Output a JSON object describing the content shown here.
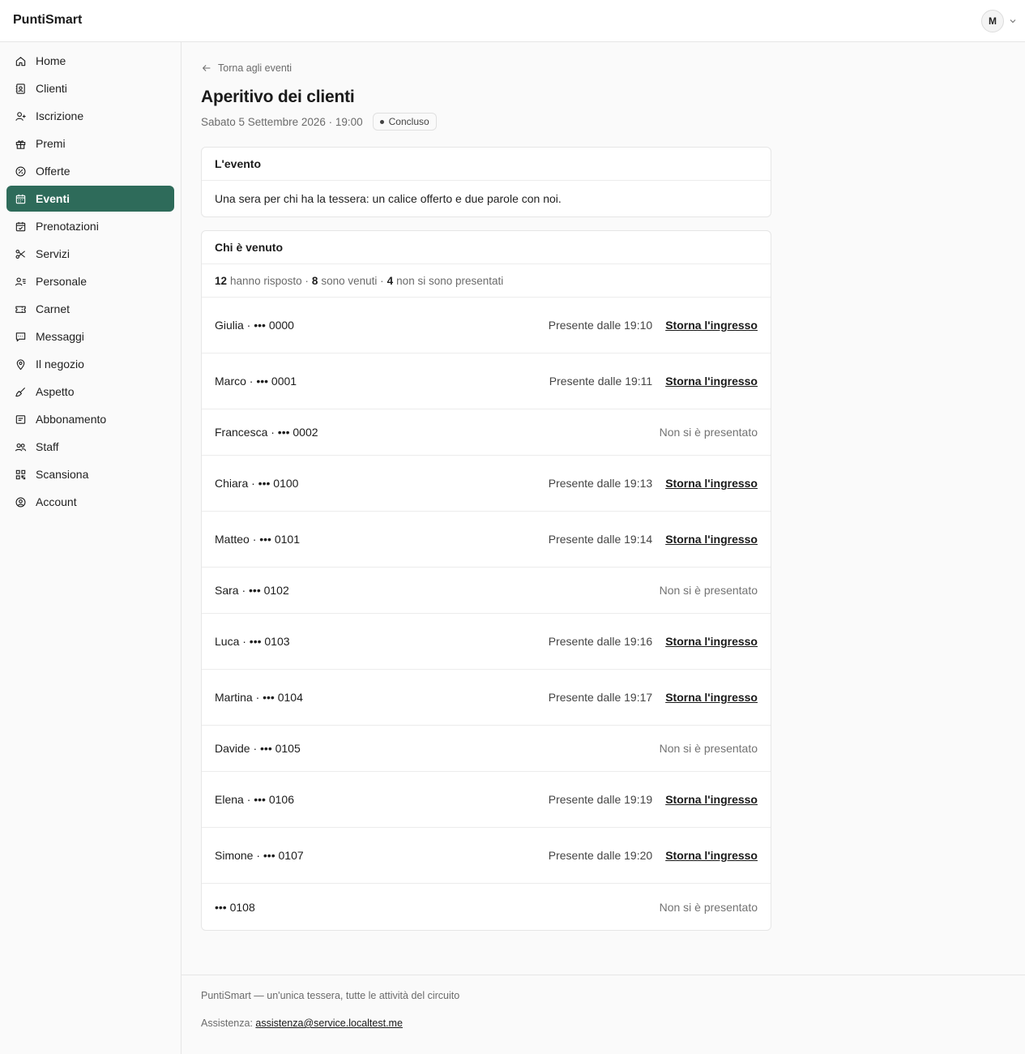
{
  "app": {
    "brand": "PuntiSmart",
    "avatar_initial": "M"
  },
  "sidebar": {
    "items": [
      {
        "label": "Home",
        "icon": "home-icon"
      },
      {
        "label": "Clienti",
        "icon": "contacts-icon"
      },
      {
        "label": "Iscrizione",
        "icon": "user-plus-icon"
      },
      {
        "label": "Premi",
        "icon": "gift-icon"
      },
      {
        "label": "Offerte",
        "icon": "percent-badge-icon"
      },
      {
        "label": "Eventi",
        "icon": "calendar-icon",
        "active": true
      },
      {
        "label": "Prenotazioni",
        "icon": "calendar-check-icon"
      },
      {
        "label": "Servizi",
        "icon": "scissors-icon"
      },
      {
        "label": "Personale",
        "icon": "user-list-icon"
      },
      {
        "label": "Carnet",
        "icon": "ticket-icon"
      },
      {
        "label": "Messaggi",
        "icon": "message-icon"
      },
      {
        "label": "Il negozio",
        "icon": "map-pin-icon"
      },
      {
        "label": "Aspetto",
        "icon": "brush-icon"
      },
      {
        "label": "Abbonamento",
        "icon": "receipt-icon"
      },
      {
        "label": "Staff",
        "icon": "users-icon"
      },
      {
        "label": "Scansiona",
        "icon": "qr-code-icon"
      },
      {
        "label": "Account",
        "icon": "user-circle-icon"
      }
    ]
  },
  "main": {
    "back_label": "Torna agli eventi",
    "title": "Aperitivo dei clienti",
    "datetime": "Sabato 5 Settembre 2026 · 19:00",
    "status": "Concluso",
    "event_card": {
      "heading": "L'evento",
      "description": "Una sera per chi ha la tessera: un calice offerto e due parole con noi."
    },
    "attendance_card": {
      "heading": "Chi è venuto",
      "summary": {
        "responded_count": "12",
        "responded_label": "hanno risposto ·",
        "came_count": "8",
        "came_label": "sono venuti ·",
        "noshow_count": "4",
        "noshow_label": "non si sono presentati"
      },
      "undo_label": "Storna l'ingresso",
      "rows": [
        {
          "name": "Giulia · ••• 0000",
          "status": "Presente dalle 19:10",
          "present": true
        },
        {
          "name": "Marco · ••• 0001",
          "status": "Presente dalle 19:11",
          "present": true
        },
        {
          "name": "Francesca · ••• 0002",
          "status": "Non si è presentato",
          "present": false
        },
        {
          "name": "Chiara · ••• 0100",
          "status": "Presente dalle 19:13",
          "present": true
        },
        {
          "name": "Matteo · ••• 0101",
          "status": "Presente dalle 19:14",
          "present": true
        },
        {
          "name": "Sara · ••• 0102",
          "status": "Non si è presentato",
          "present": false
        },
        {
          "name": "Luca · ••• 0103",
          "status": "Presente dalle 19:16",
          "present": true
        },
        {
          "name": "Martina · ••• 0104",
          "status": "Presente dalle 19:17",
          "present": true
        },
        {
          "name": "Davide · ••• 0105",
          "status": "Non si è presentato",
          "present": false
        },
        {
          "name": "Elena · ••• 0106",
          "status": "Presente dalle 19:19",
          "present": true
        },
        {
          "name": "Simone · ••• 0107",
          "status": "Presente dalle 19:20",
          "present": true
        },
        {
          "name": "••• 0108",
          "status": "Non si è presentato",
          "present": false
        }
      ]
    }
  },
  "footer": {
    "tagline": "PuntiSmart — un'unica tessera, tutte le attività del circuito",
    "support_label": "Assistenza:",
    "support_email": "assistenza@service.localtest.me"
  },
  "colors": {
    "accent": "#2e6b5a",
    "border": "#e6e6e6",
    "muted_text": "#6b6b6b"
  }
}
